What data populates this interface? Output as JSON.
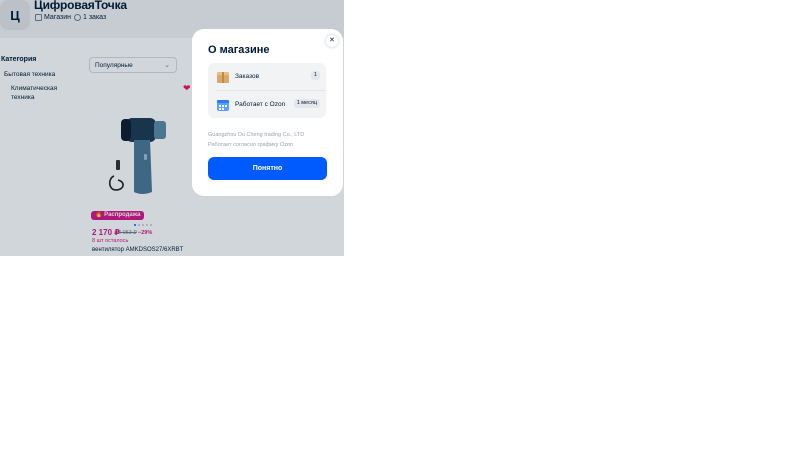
{
  "shop": {
    "avatar_letter": "Ц",
    "name": "ЦифроваяТочка",
    "chips": [
      {
        "icon": "store-icon",
        "label": "Магазин"
      },
      {
        "icon": "orders-icon",
        "label": "1 заказ"
      }
    ]
  },
  "filters": {
    "category_title": "Категория",
    "categories": [
      "Бытовая техника",
      "Климатическая техника"
    ],
    "sort_value": "Популярные"
  },
  "product": {
    "badge": "Распродажа",
    "price": "2 170 ₽",
    "old_price": "3 053 ₽",
    "discount": "−29%",
    "stock": "8 шт осталось",
    "name": "вентилятор AMKDSOS27/6XRBT",
    "image_icon": "handheld-fan-image",
    "favorite_icon": "heart-icon"
  },
  "modal": {
    "title": "О магазине",
    "close_icon": "close-icon",
    "stats": [
      {
        "icon": "box-icon",
        "label": "Заказов",
        "value": "1"
      },
      {
        "icon": "calendar-icon",
        "label": "Работает с Ozon",
        "value": "1 месяц"
      }
    ],
    "company": "Guangzhou Du Cheng trading Co., LTD",
    "schedule": "Работает согласно графику Ozon",
    "button_label": "Понятно"
  },
  "colors": {
    "accent": "#005bff",
    "sale": "#d8158c",
    "text": "#001a34",
    "muted": "#99a3ae",
    "background": "#f2f3f5"
  }
}
